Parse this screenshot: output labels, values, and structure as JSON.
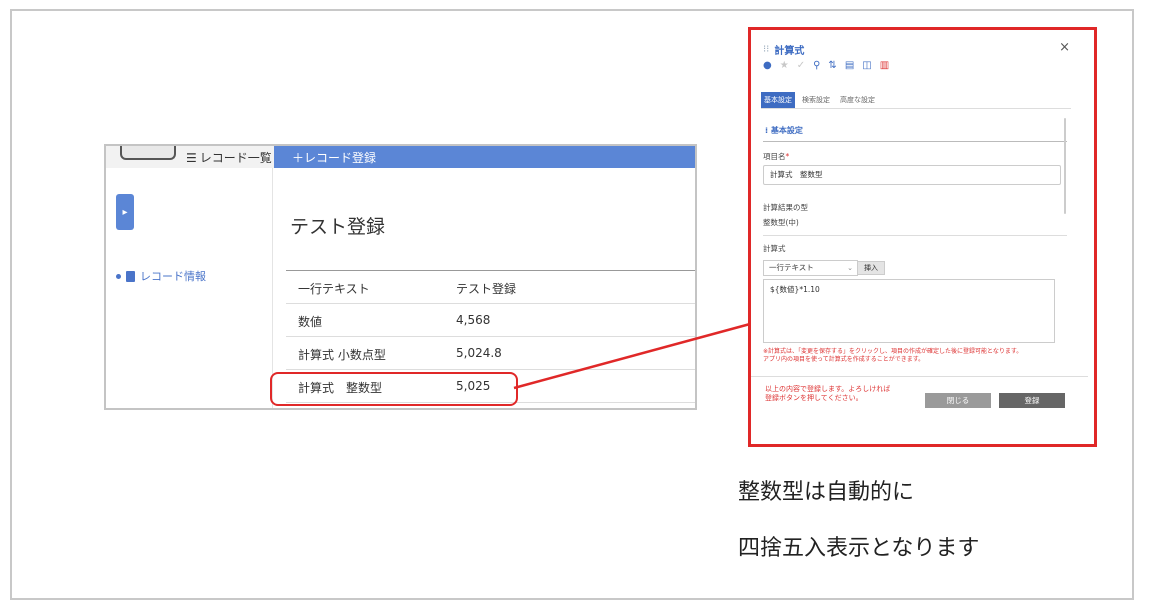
{
  "app": {
    "topbar": {
      "list_label": "レコード一覧",
      "register_label": "＋レコード登録"
    },
    "side": {
      "item_label": "レコード情報"
    },
    "title": "テスト登録",
    "rows": [
      {
        "key": "一行テキスト",
        "value": "テスト登録"
      },
      {
        "key": "数値",
        "value": "4,568"
      },
      {
        "key": "計算式 小数点型",
        "value": "5,024.8"
      },
      {
        "key": "計算式　整数型",
        "value": "5,025"
      }
    ]
  },
  "dialog": {
    "title": "計算式",
    "close": "×",
    "tabs": [
      "基本設定",
      "検索設定",
      "高度な設定"
    ],
    "section": "基本設定",
    "name_label": "項目名",
    "required_mark": "*",
    "name_value": "計算式　整数型",
    "result_type_label": "計算結果の型",
    "result_type_value": "整数型(中)",
    "formula_label": "計算式",
    "select_value": "一行テキスト",
    "insert_button": "挿入",
    "formula_value": "${数値}*1.10",
    "note": "※計算式は、「変更を保存する」をクリックし、項目の作成が確定した後に登録可能となります。\nアプリ内の項目を使って計算式を作成することができます。",
    "footer_msg": "以上の内容で登録します。よろしければ登録ボタンを押してください。",
    "close_button": "閉じる",
    "register_button": "登録"
  },
  "caption": {
    "line1": "整数型は自動的に",
    "line2": "四捨五入表示となります"
  },
  "colors": {
    "accent": "#5b86d6",
    "highlight": "#e02828"
  }
}
